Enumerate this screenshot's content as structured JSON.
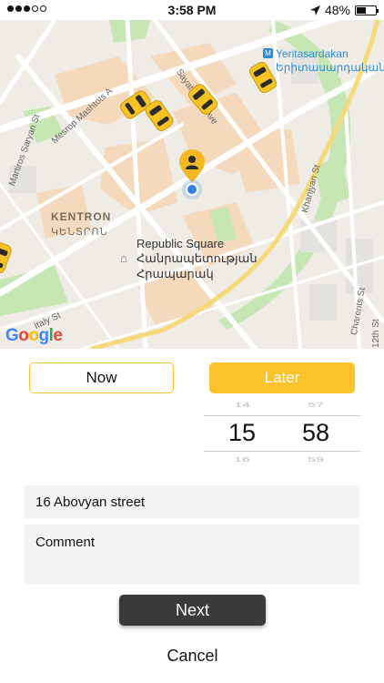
{
  "status_bar": {
    "time": "3:58 PM",
    "battery_text": "48%",
    "battery_level": 0.48,
    "signal_bars_filled": 3,
    "signal_bars_total": 5,
    "location_icon": "location-arrow-icon"
  },
  "map": {
    "streets": {
      "mesrop": "Mesrop Mashtots A",
      "sayat": "Sayat-Nova Ave",
      "martiros": "Martiros Saryan St",
      "khanjyan": "Khanjyan St",
      "italy": "Italy St",
      "charents": "Charents St",
      "twelfth": "12th St"
    },
    "district": {
      "name": "KENTRON",
      "name_local": "ԿԵՆՏՐՈՆ"
    },
    "poi": {
      "name": "Republic Square",
      "line2": "Հանրապետության",
      "line3": "Հրապարակ"
    },
    "metro": {
      "name": "Yeritasardakan",
      "name_local": "Երիտասարդական"
    },
    "attribution": "Google",
    "colors": {
      "taxi": "#f6c323",
      "pin": "#f4b823",
      "location": "#2f7fe0"
    }
  },
  "time_mode": {
    "now_label": "Now",
    "later_label": "Later",
    "selected": "Later"
  },
  "picker": {
    "hour": "15",
    "minute": "58",
    "hour_above": "14",
    "minute_above": "57",
    "hour_below": "16",
    "minute_below": "59"
  },
  "form": {
    "address_value": "16 Abovyan street",
    "comment_placeholder": "Comment"
  },
  "actions": {
    "next_label": "Next",
    "cancel_label": "Cancel"
  },
  "theme": {
    "accent": "#fbc22d",
    "dark_button": "#3a3a3c"
  }
}
